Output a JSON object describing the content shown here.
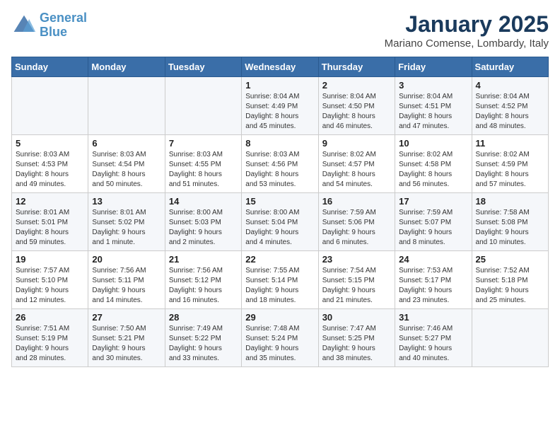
{
  "header": {
    "logo_line1": "General",
    "logo_line2": "Blue",
    "title": "January 2025",
    "subtitle": "Mariano Comense, Lombardy, Italy"
  },
  "days_of_week": [
    "Sunday",
    "Monday",
    "Tuesday",
    "Wednesday",
    "Thursday",
    "Friday",
    "Saturday"
  ],
  "weeks": [
    [
      {
        "day": "",
        "info": ""
      },
      {
        "day": "",
        "info": ""
      },
      {
        "day": "",
        "info": ""
      },
      {
        "day": "1",
        "info": "Sunrise: 8:04 AM\nSunset: 4:49 PM\nDaylight: 8 hours\nand 45 minutes."
      },
      {
        "day": "2",
        "info": "Sunrise: 8:04 AM\nSunset: 4:50 PM\nDaylight: 8 hours\nand 46 minutes."
      },
      {
        "day": "3",
        "info": "Sunrise: 8:04 AM\nSunset: 4:51 PM\nDaylight: 8 hours\nand 47 minutes."
      },
      {
        "day": "4",
        "info": "Sunrise: 8:04 AM\nSunset: 4:52 PM\nDaylight: 8 hours\nand 48 minutes."
      }
    ],
    [
      {
        "day": "5",
        "info": "Sunrise: 8:03 AM\nSunset: 4:53 PM\nDaylight: 8 hours\nand 49 minutes."
      },
      {
        "day": "6",
        "info": "Sunrise: 8:03 AM\nSunset: 4:54 PM\nDaylight: 8 hours\nand 50 minutes."
      },
      {
        "day": "7",
        "info": "Sunrise: 8:03 AM\nSunset: 4:55 PM\nDaylight: 8 hours\nand 51 minutes."
      },
      {
        "day": "8",
        "info": "Sunrise: 8:03 AM\nSunset: 4:56 PM\nDaylight: 8 hours\nand 53 minutes."
      },
      {
        "day": "9",
        "info": "Sunrise: 8:02 AM\nSunset: 4:57 PM\nDaylight: 8 hours\nand 54 minutes."
      },
      {
        "day": "10",
        "info": "Sunrise: 8:02 AM\nSunset: 4:58 PM\nDaylight: 8 hours\nand 56 minutes."
      },
      {
        "day": "11",
        "info": "Sunrise: 8:02 AM\nSunset: 4:59 PM\nDaylight: 8 hours\nand 57 minutes."
      }
    ],
    [
      {
        "day": "12",
        "info": "Sunrise: 8:01 AM\nSunset: 5:01 PM\nDaylight: 8 hours\nand 59 minutes."
      },
      {
        "day": "13",
        "info": "Sunrise: 8:01 AM\nSunset: 5:02 PM\nDaylight: 9 hours\nand 1 minute."
      },
      {
        "day": "14",
        "info": "Sunrise: 8:00 AM\nSunset: 5:03 PM\nDaylight: 9 hours\nand 2 minutes."
      },
      {
        "day": "15",
        "info": "Sunrise: 8:00 AM\nSunset: 5:04 PM\nDaylight: 9 hours\nand 4 minutes."
      },
      {
        "day": "16",
        "info": "Sunrise: 7:59 AM\nSunset: 5:06 PM\nDaylight: 9 hours\nand 6 minutes."
      },
      {
        "day": "17",
        "info": "Sunrise: 7:59 AM\nSunset: 5:07 PM\nDaylight: 9 hours\nand 8 minutes."
      },
      {
        "day": "18",
        "info": "Sunrise: 7:58 AM\nSunset: 5:08 PM\nDaylight: 9 hours\nand 10 minutes."
      }
    ],
    [
      {
        "day": "19",
        "info": "Sunrise: 7:57 AM\nSunset: 5:10 PM\nDaylight: 9 hours\nand 12 minutes."
      },
      {
        "day": "20",
        "info": "Sunrise: 7:56 AM\nSunset: 5:11 PM\nDaylight: 9 hours\nand 14 minutes."
      },
      {
        "day": "21",
        "info": "Sunrise: 7:56 AM\nSunset: 5:12 PM\nDaylight: 9 hours\nand 16 minutes."
      },
      {
        "day": "22",
        "info": "Sunrise: 7:55 AM\nSunset: 5:14 PM\nDaylight: 9 hours\nand 18 minutes."
      },
      {
        "day": "23",
        "info": "Sunrise: 7:54 AM\nSunset: 5:15 PM\nDaylight: 9 hours\nand 21 minutes."
      },
      {
        "day": "24",
        "info": "Sunrise: 7:53 AM\nSunset: 5:17 PM\nDaylight: 9 hours\nand 23 minutes."
      },
      {
        "day": "25",
        "info": "Sunrise: 7:52 AM\nSunset: 5:18 PM\nDaylight: 9 hours\nand 25 minutes."
      }
    ],
    [
      {
        "day": "26",
        "info": "Sunrise: 7:51 AM\nSunset: 5:19 PM\nDaylight: 9 hours\nand 28 minutes."
      },
      {
        "day": "27",
        "info": "Sunrise: 7:50 AM\nSunset: 5:21 PM\nDaylight: 9 hours\nand 30 minutes."
      },
      {
        "day": "28",
        "info": "Sunrise: 7:49 AM\nSunset: 5:22 PM\nDaylight: 9 hours\nand 33 minutes."
      },
      {
        "day": "29",
        "info": "Sunrise: 7:48 AM\nSunset: 5:24 PM\nDaylight: 9 hours\nand 35 minutes."
      },
      {
        "day": "30",
        "info": "Sunrise: 7:47 AM\nSunset: 5:25 PM\nDaylight: 9 hours\nand 38 minutes."
      },
      {
        "day": "31",
        "info": "Sunrise: 7:46 AM\nSunset: 5:27 PM\nDaylight: 9 hours\nand 40 minutes."
      },
      {
        "day": "",
        "info": ""
      }
    ]
  ]
}
